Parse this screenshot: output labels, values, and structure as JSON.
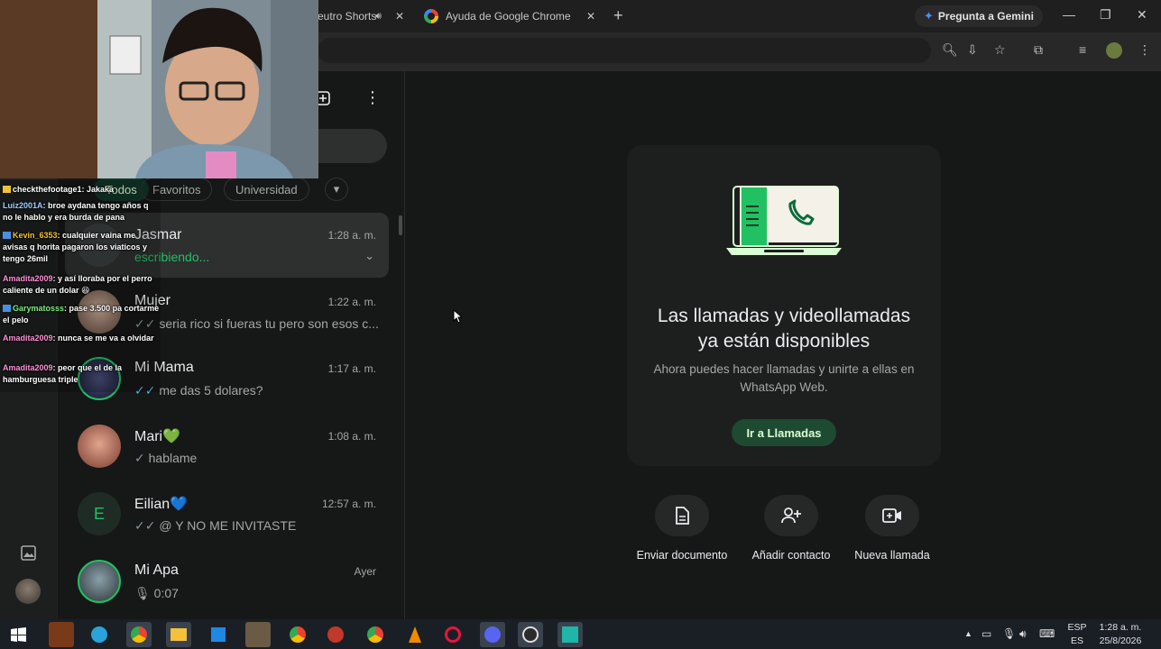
{
  "browser": {
    "tabs": [
      {
        "title": "eutro Shorts"
      },
      {
        "title": "Ayuda de Google Chrome"
      }
    ],
    "gemini_label": "Pregunta a Gemini"
  },
  "whatsapp": {
    "filters": [
      "Todos",
      "Favoritos",
      "Universidad"
    ],
    "chats": [
      {
        "name": "Jasmar",
        "time": "1:28 a. m.",
        "preview": "escribiendo..."
      },
      {
        "name": "Mujer",
        "time": "1:22 a. m.",
        "preview": "seria rico si fueras tu pero son esos c..."
      },
      {
        "name": "Mi Mama",
        "time": "1:17 a. m.",
        "preview": "me das 5 dolares?"
      },
      {
        "name": "Mari💚",
        "time": "1:08 a. m.",
        "preview": "hablame"
      },
      {
        "name": "Eilian💙",
        "time": "12:57 a. m.",
        "preview": "Y NO ME INVITASTE",
        "avatar_letter": "E"
      },
      {
        "name": "Mi Apa",
        "time": "Ayer",
        "preview": "0:07"
      }
    ],
    "panel": {
      "title_line1": "Las llamadas y videollamadas",
      "title_line2": "ya están disponibles",
      "subtitle_line1": "Ahora puedes hacer llamadas y unirte a ellas en",
      "subtitle_line2": "WhatsApp Web.",
      "button": "Ir a Llamadas",
      "actions": [
        "Enviar documento",
        "Añadir contacto",
        "Nueva llamada"
      ]
    }
  },
  "stream_chat": [
    {
      "user": "checkthefootage1",
      "text": ": Jakaka"
    },
    {
      "user": "Luiz2001A",
      "text": ": broe aydana tengo años q no le hablo y era burda de pana"
    },
    {
      "user": "Kevin_6353",
      "text": ": cualquier vaina me avisas q horita pagaron los viaticos y tengo 26mil"
    },
    {
      "user": "Amadita2009",
      "text": ": y así lloraba por el perro caliente de un dolar 😆"
    },
    {
      "user": "Garymatosss",
      "text": ": pase 3.500 pa cortarme el pelo"
    },
    {
      "user": "Amadita2009",
      "text": ": nunca se me va a olvidar"
    },
    {
      "user": "Amadita2009",
      "text": ": peor que el de la hamburguesa triple"
    }
  ],
  "taskbar": {
    "lang1": "ESP",
    "lang2": "ES",
    "time": "1:28 a. m.",
    "date": "25/8/2026"
  },
  "colors": {
    "accent_green": "#21c063",
    "bg": "#161717",
    "panel": "#1d1f1f"
  }
}
